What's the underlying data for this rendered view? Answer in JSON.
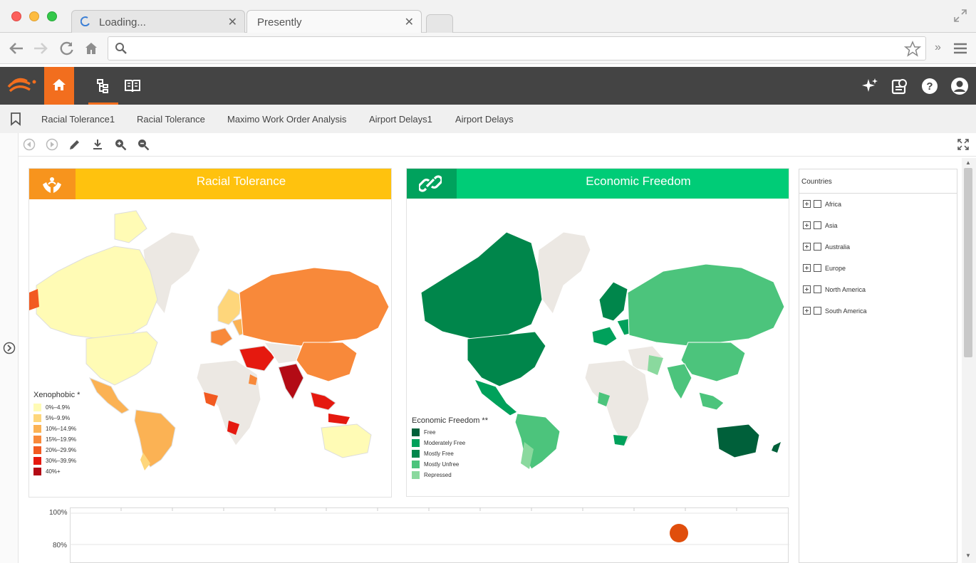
{
  "browser": {
    "tabs": [
      {
        "title": "Loading...",
        "active": false
      },
      {
        "title": "Presently",
        "active": true
      }
    ],
    "address": ""
  },
  "app": {
    "accent": "#f26e1e",
    "bookmarks": [
      "Racial Tolerance1",
      "Racial Tolerance",
      "Maximo Work Order Analysis",
      "Airport Delays1",
      "Airport Delays"
    ]
  },
  "panel_left": {
    "title": "Racial Tolerance",
    "title_color": "#ffc20e",
    "icon_bg": "#f7941d",
    "legend_title": "Xenophobic *",
    "legend": [
      {
        "label": "0%–4.9%",
        "color": "#fffbb5"
      },
      {
        "label": "5%–9.9%",
        "color": "#fed67b"
      },
      {
        "label": "10%–14.9%",
        "color": "#fbb254"
      },
      {
        "label": "15%–19.9%",
        "color": "#f8893a"
      },
      {
        "label": "20%–29.9%",
        "color": "#f25a21"
      },
      {
        "label": "30%–39.9%",
        "color": "#e5190f"
      },
      {
        "label": "40%+",
        "color": "#b30b15"
      }
    ]
  },
  "panel_right": {
    "title": "Economic Freedom",
    "title_color": "#00cc77",
    "icon_bg": "#00a25d",
    "legend_title": "Economic Freedom **",
    "legend": [
      {
        "label": "Free",
        "color": "#00603a"
      },
      {
        "label": "Moderately Free",
        "color": "#00a15b"
      },
      {
        "label": "Mostly Free",
        "color": "#00864b"
      },
      {
        "label": "Mostly Unfree",
        "color": "#4cc47c"
      },
      {
        "label": "Repressed",
        "color": "#8ad99e"
      }
    ]
  },
  "countries": {
    "title": "Countries",
    "items": [
      "Africa",
      "Asia",
      "Australia",
      "Europe",
      "North America",
      "South America"
    ]
  },
  "bottom_chart": {
    "y_ticks": [
      "100%",
      "80%"
    ]
  }
}
